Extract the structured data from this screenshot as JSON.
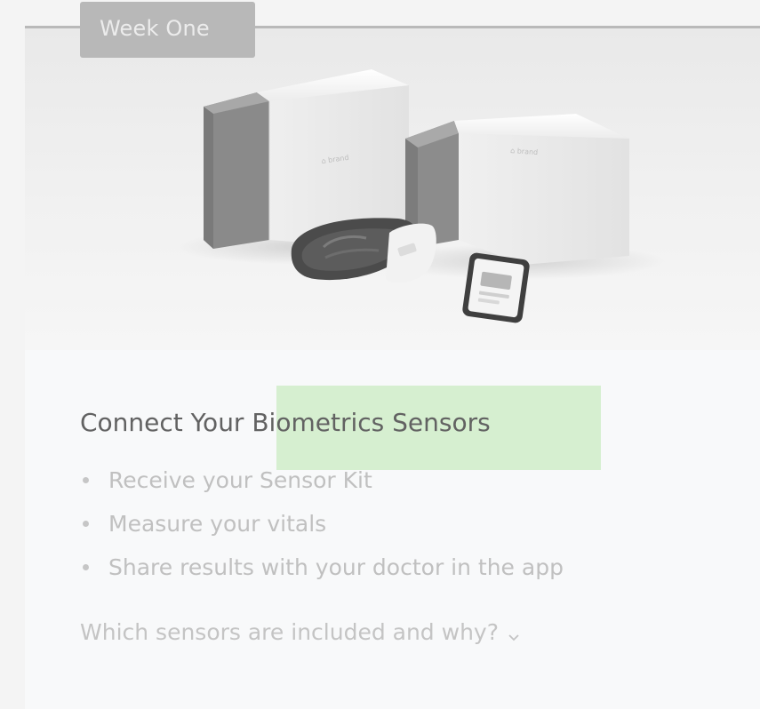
{
  "card": {
    "tab_label": "Week One",
    "title": "Connect Your Biometrics Sensors",
    "bullets": [
      "Receive your Sensor Kit",
      "Measure your vitals",
      "Share results with your doctor in the app"
    ],
    "faq_label": "Which sensors are included and why?",
    "faq_icon": "chevron-down-icon"
  },
  "colors": {
    "highlight": "#d6efd0",
    "tab_bg": "#b8b8b8",
    "title_text": "#626262",
    "muted_text": "#c0c0c0"
  }
}
